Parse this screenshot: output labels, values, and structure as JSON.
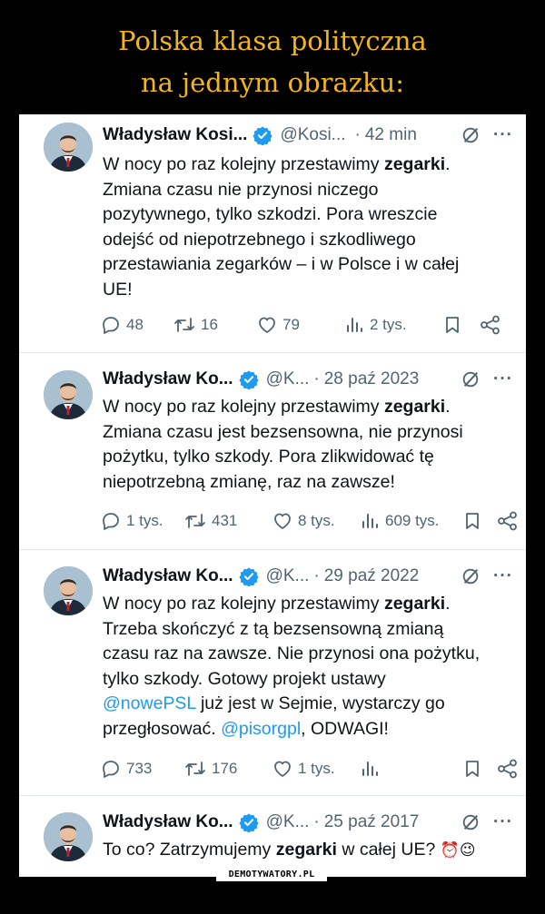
{
  "headline": {
    "line1": "Polska klasa polityczna",
    "line2": "na jednym obrazku:"
  },
  "colors": {
    "background": "#000000",
    "headline": "#f2b51b",
    "link": "#1d9bf0",
    "verified": "#1d9bf0",
    "secondary_text": "#536471"
  },
  "tweets": [
    {
      "author": "Władysław Kosi...",
      "handle": "@Kosi...",
      "separator": "·",
      "time": "42 min",
      "more": "···",
      "text_html": "W nocy po raz kolejny przestawimy <b>zegarki</b>.<br>Zmiana czasu nie przynosi niczego<br>pozytywnego, tylko szkodzi. Pora wreszcie<br>odejść od niepotrzebnego i szkodliwego<br>przestawiania zegarków – i w Polsce i w całej<br>UE!",
      "replies": "48",
      "retweets": "16",
      "likes": "79",
      "views": "2 tys."
    },
    {
      "author": "Władysław Ko...",
      "handle": "@K...",
      "separator": "·",
      "time": "28 paź 2023",
      "more": "···",
      "text_html": "W nocy po raz kolejny przestawimy <b>zegarki</b>.<br>Zmiana czasu jest bezsensowna, nie przynosi<br>pożytku, tylko szkody. Pora zlikwidować tę<br>niepotrzebną zmianę, raz na zawsze!",
      "replies": "1 tys.",
      "retweets": "431",
      "likes": "8 tys.",
      "views": "609 tys."
    },
    {
      "author": "Władysław Ko...",
      "handle": "@K...",
      "separator": "·",
      "time": "29 paź 2022",
      "more": "···",
      "text_html": "W nocy po raz kolejny przestawimy <b>zegarki</b>.<br>Trzeba skończyć z tą bezsensowną zmianą<br>czasu raz na zawsze. Nie przynosi ona pożytku,<br>tylko szkody. Gotowy projekt ustawy<br><span class=\"mention\">@nowePSL</span> już jest w Sejmie, wystarczy go<br>przegłosować. <span class=\"mention\">@pisorgpl</span>, ODWAGI!",
      "replies": "733",
      "retweets": "176",
      "likes": "1 tys.",
      "views": ""
    },
    {
      "author": "Władysław Ko...",
      "handle": "@K...",
      "separator": "·",
      "time": "25 paź 2017",
      "more": "···",
      "text_html": "To co? Zatrzymujemy <b>zegarki</b> w całej UE? <span style=\"font-size:17px\">⏰😉</span>"
    }
  ],
  "icons": {
    "avatar": "profile-photo",
    "verified": "verified-badge-icon",
    "grok": "grok-icon",
    "reply": "reply-icon",
    "retweet": "retweet-icon",
    "like": "heart-icon",
    "views": "views-chart-icon",
    "bookmark": "bookmark-icon",
    "share": "share-icon"
  },
  "watermark": "DEMOTYWATORY.PL"
}
